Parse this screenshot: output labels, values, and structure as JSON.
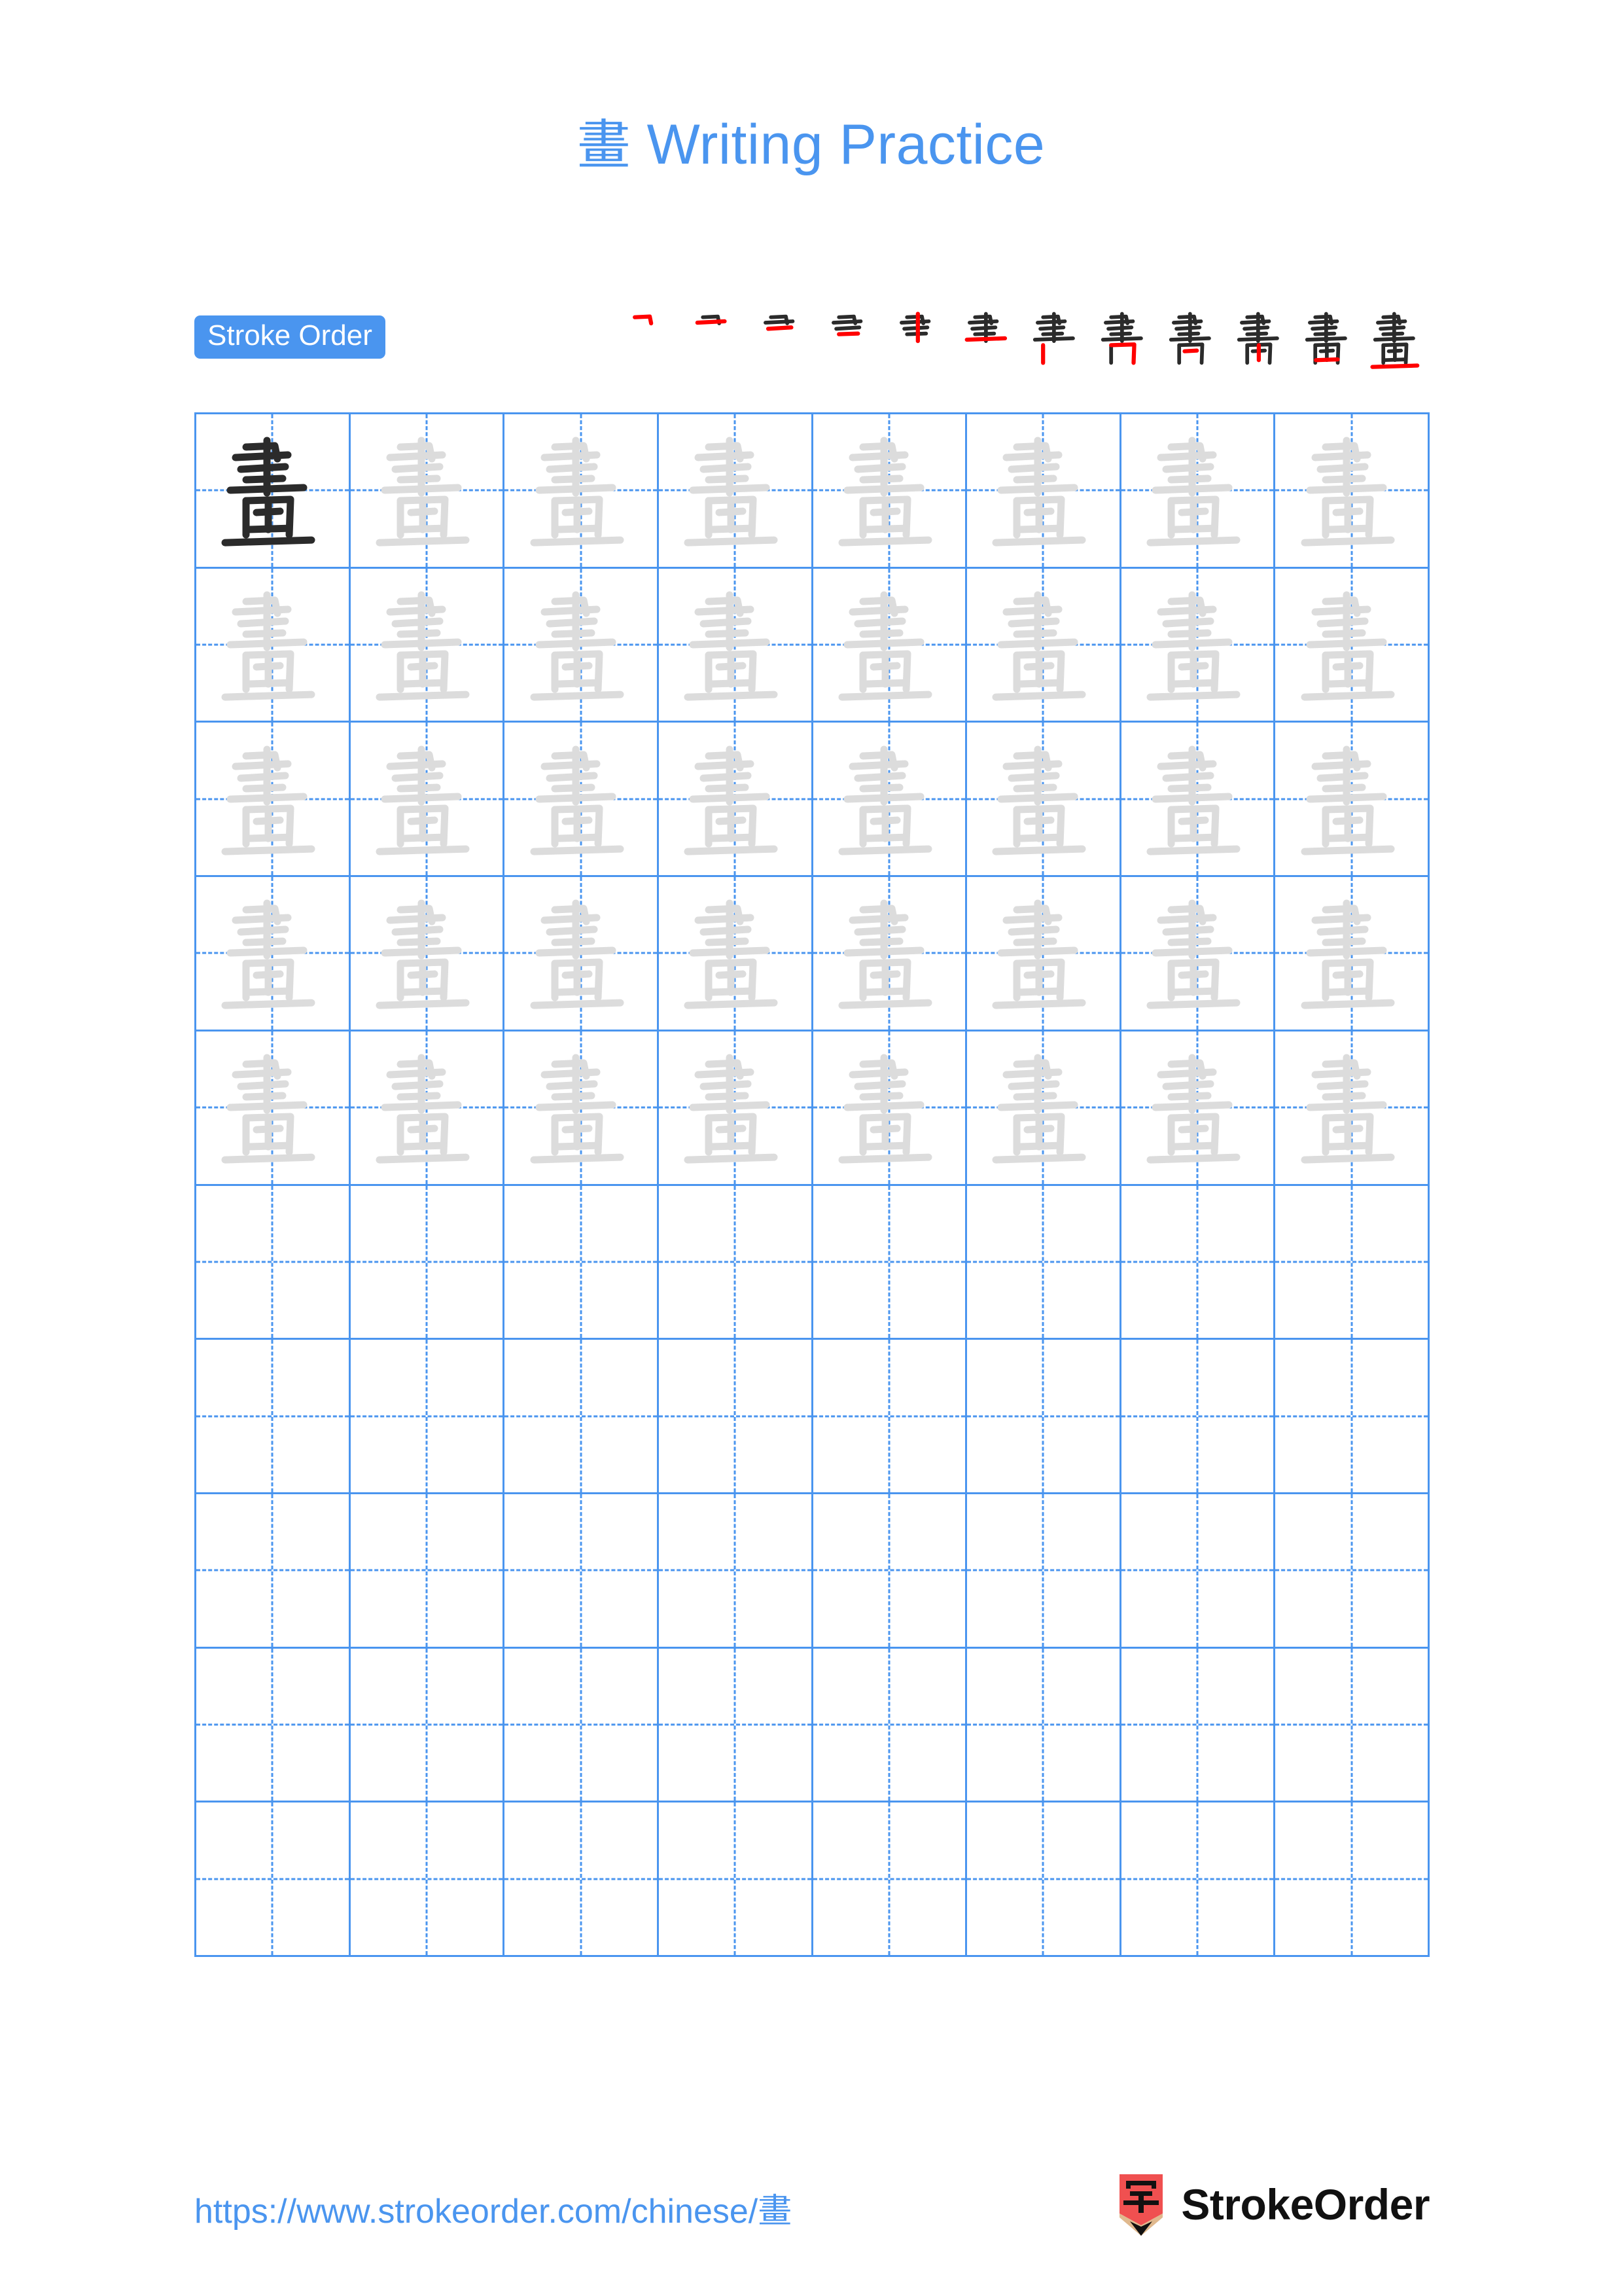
{
  "page": {
    "character": "畫",
    "title": "畫 Writing Practice",
    "title_character": "畫",
    "title_text": " Writing Practice",
    "background_color": "#ffffff",
    "accent_color": "#4a95ef",
    "trace_color": "#dcdcdc",
    "model_color": "#2b2b2b",
    "highlight_stroke_color": "#ff0000"
  },
  "stroke_order": {
    "badge_label": "Stroke Order",
    "total_strokes": 12,
    "steps": [
      {
        "index": 1,
        "strokes_shown": 1
      },
      {
        "index": 2,
        "strokes_shown": 2
      },
      {
        "index": 3,
        "strokes_shown": 3
      },
      {
        "index": 4,
        "strokes_shown": 4
      },
      {
        "index": 5,
        "strokes_shown": 5
      },
      {
        "index": 6,
        "strokes_shown": 6
      },
      {
        "index": 7,
        "strokes_shown": 7
      },
      {
        "index": 8,
        "strokes_shown": 8
      },
      {
        "index": 9,
        "strokes_shown": 9
      },
      {
        "index": 10,
        "strokes_shown": 10
      },
      {
        "index": 11,
        "strokes_shown": 11
      },
      {
        "index": 12,
        "strokes_shown": 12
      }
    ]
  },
  "grid": {
    "columns": 8,
    "rows": 10,
    "filled_rows": 5,
    "empty_rows": 5,
    "cells": [
      [
        "model",
        "trace",
        "trace",
        "trace",
        "trace",
        "trace",
        "trace",
        "trace"
      ],
      [
        "trace",
        "trace",
        "trace",
        "trace",
        "trace",
        "trace",
        "trace",
        "trace"
      ],
      [
        "trace",
        "trace",
        "trace",
        "trace",
        "trace",
        "trace",
        "trace",
        "trace"
      ],
      [
        "trace",
        "trace",
        "trace",
        "trace",
        "trace",
        "trace",
        "trace",
        "trace"
      ],
      [
        "trace",
        "trace",
        "trace",
        "trace",
        "trace",
        "trace",
        "trace",
        "trace"
      ],
      [
        "empty",
        "empty",
        "empty",
        "empty",
        "empty",
        "empty",
        "empty",
        "empty"
      ],
      [
        "empty",
        "empty",
        "empty",
        "empty",
        "empty",
        "empty",
        "empty",
        "empty"
      ],
      [
        "empty",
        "empty",
        "empty",
        "empty",
        "empty",
        "empty",
        "empty",
        "empty"
      ],
      [
        "empty",
        "empty",
        "empty",
        "empty",
        "empty",
        "empty",
        "empty",
        "empty"
      ],
      [
        "empty",
        "empty",
        "empty",
        "empty",
        "empty",
        "empty",
        "empty",
        "empty"
      ]
    ]
  },
  "footer": {
    "url_prefix": "https://www.strokeorder.com/chinese/",
    "url_character": "畫",
    "url": "https://www.strokeorder.com/chinese/畫",
    "brand_name": "StrokeOrder",
    "brand_mark_character": "字",
    "brand_mark_color": "#f05050",
    "brand_mark_tip_color": "#e0b98e"
  }
}
